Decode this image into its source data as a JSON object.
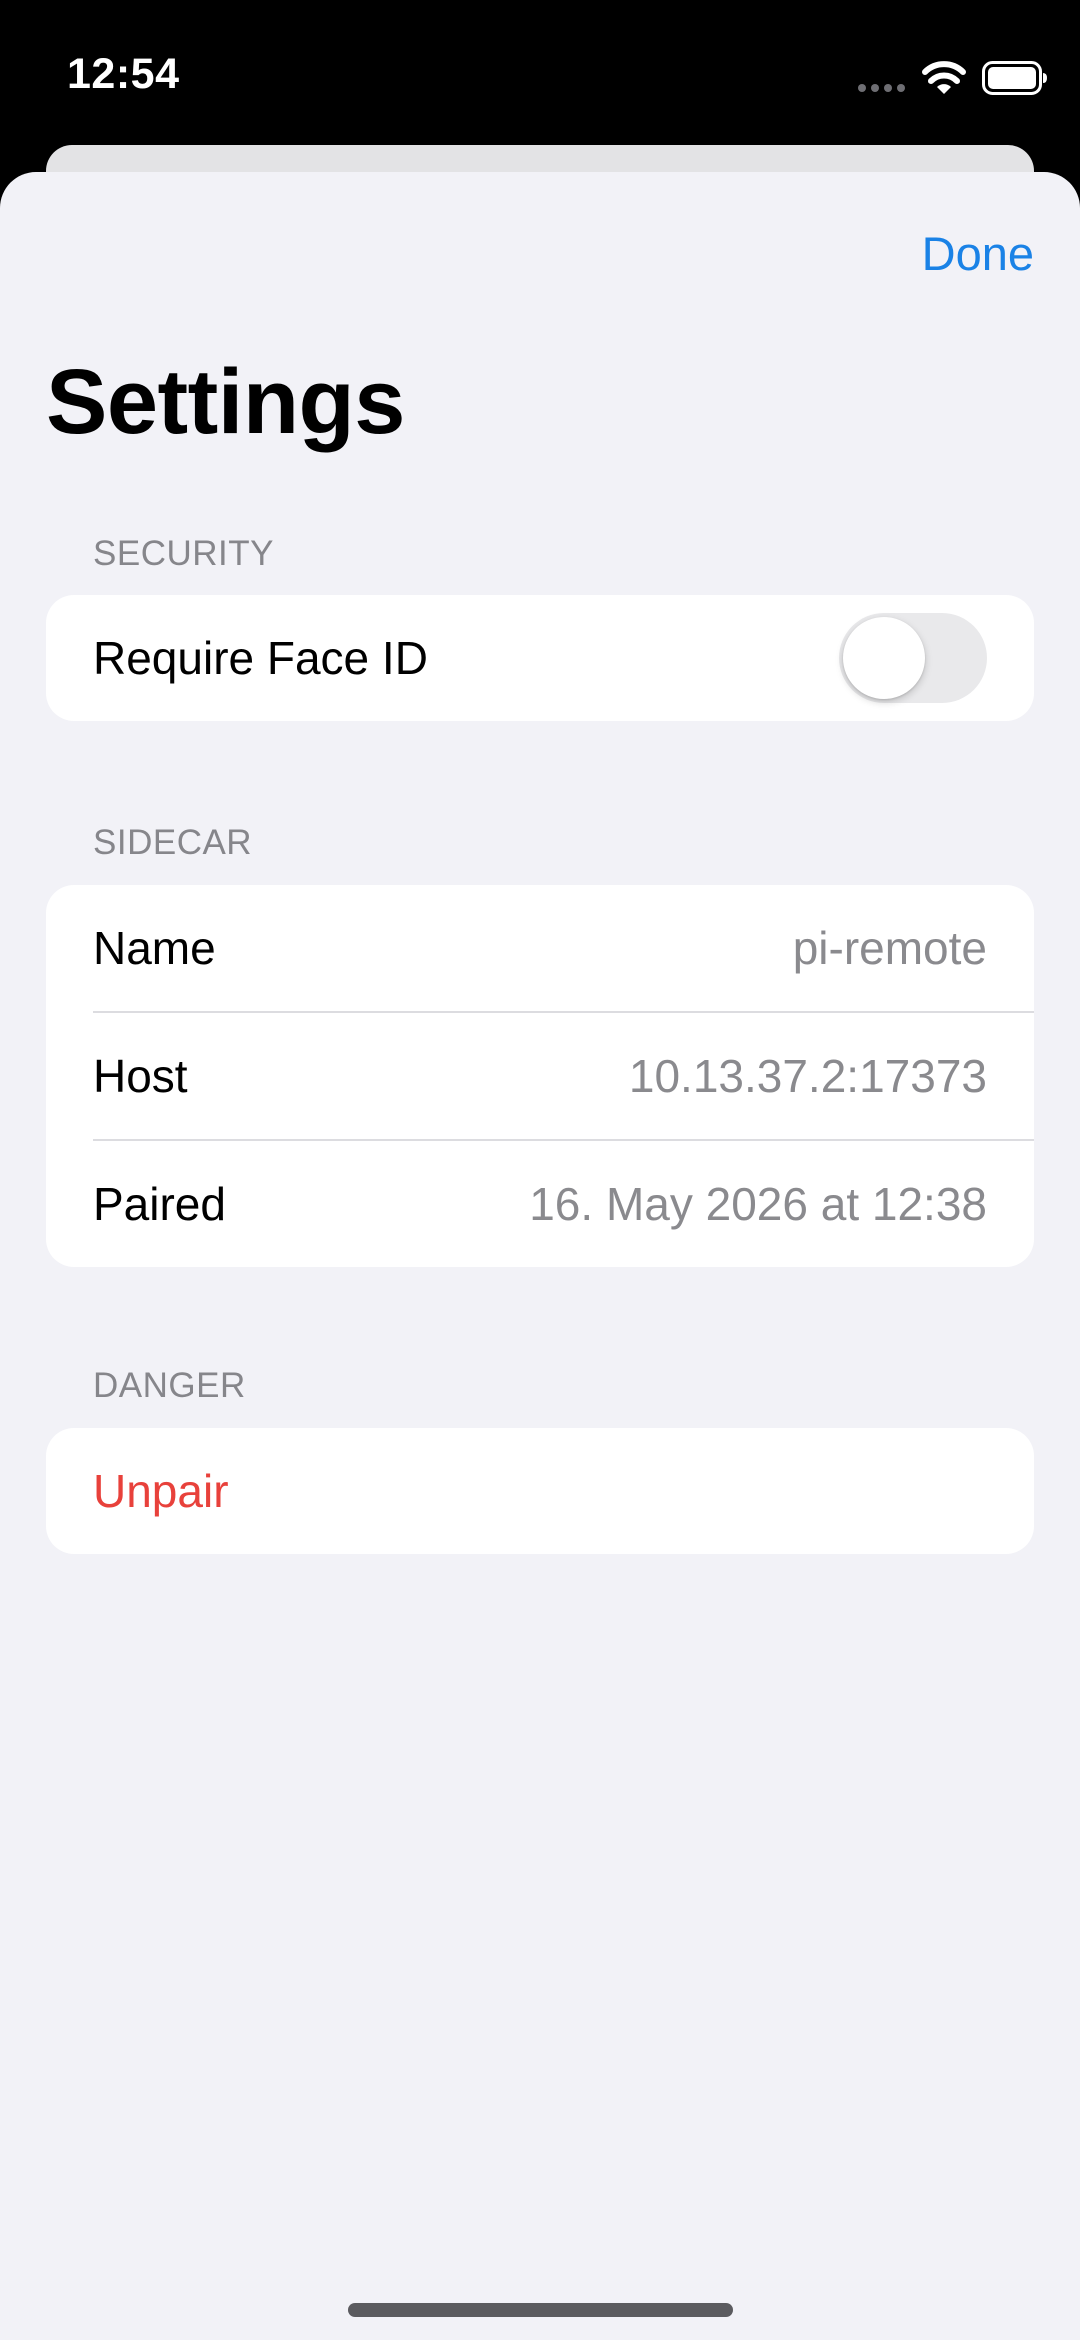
{
  "status_bar": {
    "time": "12:54",
    "icons": [
      "cellular-dots-icon",
      "wifi-icon",
      "battery-icon"
    ]
  },
  "nav": {
    "done_label": "Done",
    "title": "Settings"
  },
  "sections": {
    "security": {
      "header": "SECURITY",
      "require_face_id": {
        "label": "Require Face ID",
        "enabled": false
      }
    },
    "sidecar": {
      "header": "SIDECAR",
      "rows": [
        {
          "label": "Name",
          "value": "pi-remote"
        },
        {
          "label": "Host",
          "value": "10.13.37.2:17373"
        },
        {
          "label": "Paired",
          "value": "16. May 2026 at 12:38"
        }
      ]
    },
    "danger": {
      "header": "DANGER",
      "unpair_label": "Unpair"
    }
  },
  "colors": {
    "accent": "#1a82e6",
    "destructive": "#e8413b",
    "background": "#f2f2f7",
    "secondary_text": "#8a8a8e"
  }
}
